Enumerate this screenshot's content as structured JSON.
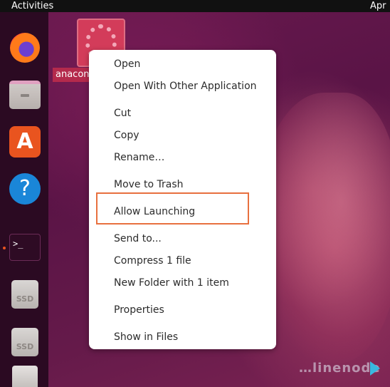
{
  "topbar": {
    "activities_label": "Activities",
    "clock_label": "Apr"
  },
  "dock": {
    "items": [
      {
        "name": "firefox",
        "icon": "firefox-icon"
      },
      {
        "name": "files",
        "icon": "files-icon"
      },
      {
        "name": "software",
        "icon": "app-store-icon",
        "glyph": "A"
      },
      {
        "name": "help",
        "icon": "help-icon",
        "glyph": "?"
      },
      {
        "name": "terminal",
        "icon": "terminal-icon",
        "glyph": ">_",
        "running": true
      },
      {
        "name": "ssd-1",
        "icon": "drive-icon",
        "label": "SSD"
      },
      {
        "name": "ssd-2",
        "icon": "drive-icon",
        "label": "SSD"
      },
      {
        "name": "document",
        "icon": "document-icon"
      }
    ]
  },
  "desktop": {
    "icon_label": "anacon"
  },
  "context_menu": {
    "items": [
      {
        "label": "Open"
      },
      {
        "label": "Open With Other Application"
      },
      {
        "label": "Cut"
      },
      {
        "label": "Copy"
      },
      {
        "label": "Rename…"
      },
      {
        "label": "Move to Trash"
      },
      {
        "label": "Allow Launching",
        "highlighted": true
      },
      {
        "label": "Send to..."
      },
      {
        "label": "Compress 1 file"
      },
      {
        "label": "New Folder with 1 item"
      },
      {
        "label": "Properties"
      },
      {
        "label": "Show in Files"
      }
    ]
  },
  "colors": {
    "highlight_box": "#e8703f",
    "topbar": "#111111",
    "dock": "#2b0a22"
  },
  "watermark": {
    "text": "…linenode"
  }
}
